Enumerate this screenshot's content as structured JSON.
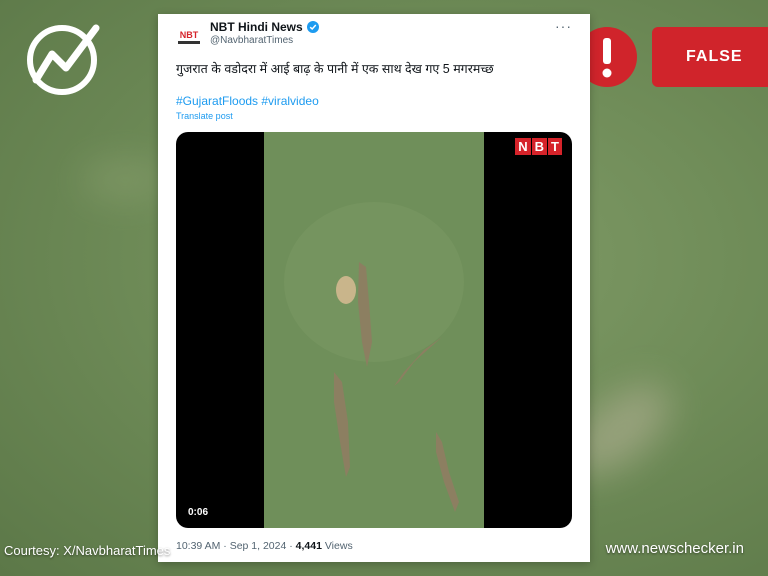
{
  "post": {
    "account_name": "NBT Hindi News",
    "handle": "@NavbharatTimes",
    "text": "गुजरात के वडोदरा में आई बाढ़ के पानी में एक साथ देख गए 5 मगरमच्छ",
    "hashtags": "#GujaratFloods #viralvideo",
    "translate": "Translate post",
    "more": "···",
    "time": "10:39 AM · Sep 1, 2024 · ",
    "views_count": "4,441",
    "views_label": " Views"
  },
  "video": {
    "watermark": [
      "N",
      "B",
      "T"
    ],
    "timestamp": "0:06"
  },
  "verdict": {
    "label": "FALSE",
    "color": "#d0242b"
  },
  "footer": {
    "courtesy": "Courtesy: X/NavbharatTimes",
    "site": "www.newschecker.in"
  },
  "colors": {
    "link": "#1d9bf0",
    "water": "#6f8f5a"
  }
}
